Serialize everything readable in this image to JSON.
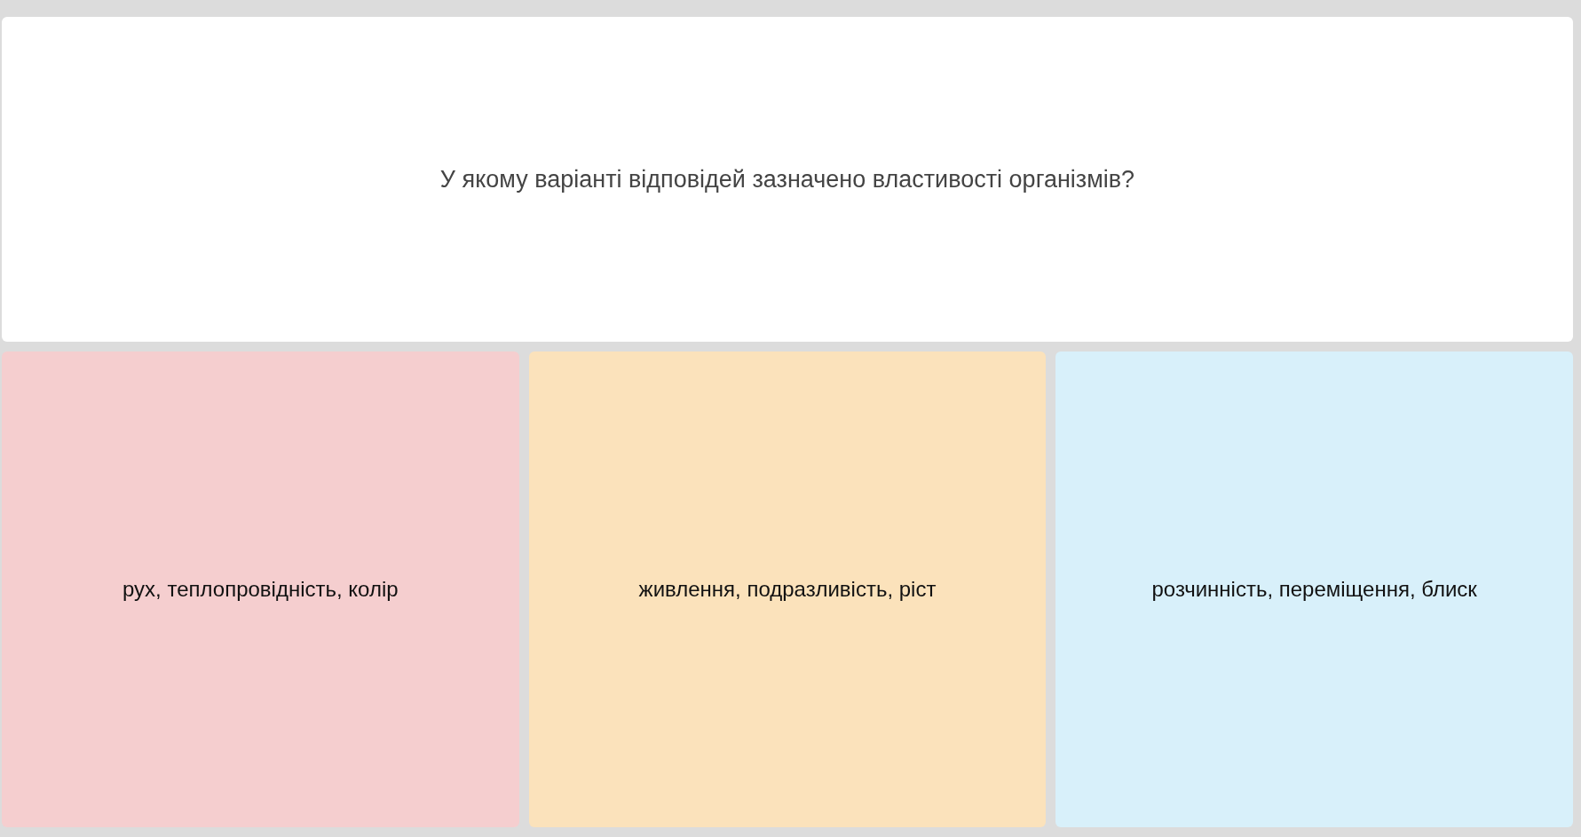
{
  "question": "У якому варіанті відповідей зазначено властивості організмів?",
  "answers": [
    {
      "text": "рух, теплопровідність, колір",
      "color": "#f5cecf"
    },
    {
      "text": "живлення, подразливість, ріст",
      "color": "#fbe2bb"
    },
    {
      "text": "розчинність, переміщення, блиск",
      "color": "#d8f0fa"
    }
  ]
}
